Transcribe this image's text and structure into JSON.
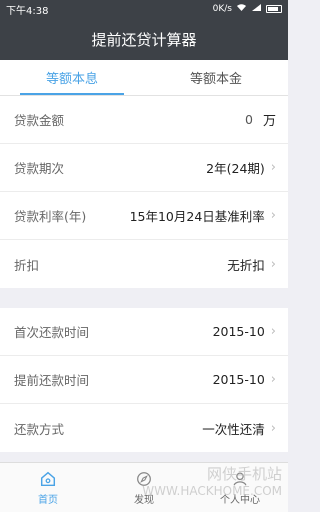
{
  "status": {
    "time": "下午4:38",
    "network": "0K/s"
  },
  "header": {
    "title": "提前还贷计算器"
  },
  "tabs": [
    {
      "label": "等额本息",
      "active": true
    },
    {
      "label": "等额本金",
      "active": false
    }
  ],
  "loan": {
    "amount_label": "贷款金额",
    "amount_value": "0",
    "amount_unit": "万",
    "term_label": "贷款期次",
    "term_value": "2年(24期)",
    "rate_label": "贷款利率(年)",
    "rate_value": "15年10月24日基准利率",
    "discount_label": "折扣",
    "discount_value": "无折扣"
  },
  "repayment": {
    "first_label": "首次还款时间",
    "first_value": "2015-10",
    "early_label": "提前还款时间",
    "early_value": "2015-10",
    "method_label": "还款方式",
    "method_value": "一次性还清"
  },
  "bottom_nav": [
    {
      "label": "首页",
      "active": true
    },
    {
      "label": "发现",
      "active": false
    },
    {
      "label": "个人中心",
      "active": false
    }
  ],
  "watermark": {
    "line1": "网侠手机站",
    "line2": "WWW.HACKHOME.COM"
  },
  "colors": {
    "accent": "#4aa3e6",
    "header": "#3d4147"
  }
}
